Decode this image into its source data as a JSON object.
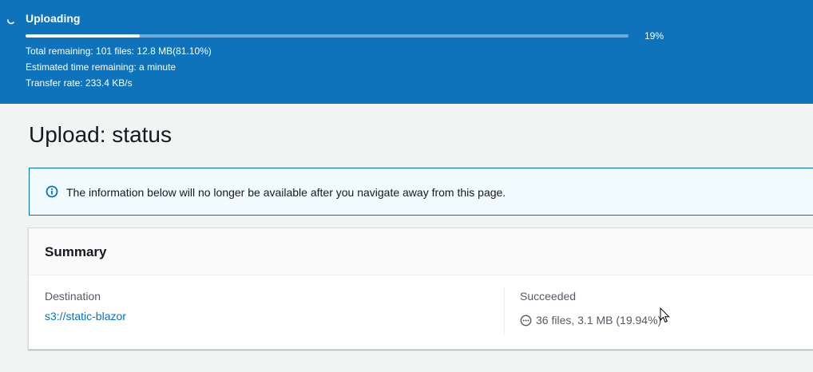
{
  "banner": {
    "title": "Uploading",
    "progress_percent": 19,
    "progress_label": "19%",
    "total_remaining": "Total remaining: 101 files: 12.8 MB(81.10%)",
    "estimated_time": "Estimated time remaining: a minute",
    "transfer_rate": "Transfer rate: 233.4 KB/s",
    "background_color": "#0f73bc",
    "icon": "spinner-icon"
  },
  "page": {
    "title": "Upload: status"
  },
  "info_alert": {
    "text": "The information below will no longer be available after you navigate away from this page.",
    "icon": "info-icon",
    "accent_color": "#0073bb"
  },
  "summary": {
    "title": "Summary",
    "destination_label": "Destination",
    "destination_value": "s3://static-blazor",
    "succeeded_label": "Succeeded",
    "succeeded_value": "36 files, 3.1 MB (19.94%)",
    "succeeded_icon": "in-progress-dots-icon"
  }
}
